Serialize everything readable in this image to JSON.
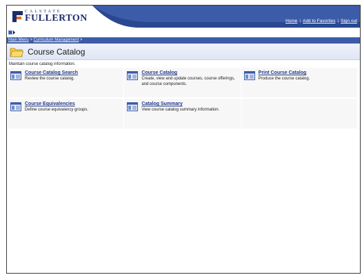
{
  "header": {
    "logo_top": "CALSTATE",
    "logo_main": "FULLERTON",
    "links": [
      "Home",
      "Add to Favorites",
      "Sign out"
    ]
  },
  "breadcrumb": {
    "items": [
      "Main Menu",
      "Curriculum Management"
    ],
    "separator": ">"
  },
  "page": {
    "title": "Course Catalog",
    "description": "Maintain course catalog information."
  },
  "items": [
    {
      "label": "Course Catalog Search",
      "desc": "Review the course catalog."
    },
    {
      "label": "Course Catalog",
      "desc": "Create, view and update courses, course offerings, and course components."
    },
    {
      "label": "Print Course Catalog",
      "desc": "Produce the course catalog."
    },
    {
      "label": "Course Equivalencies",
      "desc": "Define course equivalency groups."
    },
    {
      "label": "Catalog Summary",
      "desc": "View course catalog summary information."
    }
  ],
  "colors": {
    "brand_navy": "#1c2d6b",
    "brand_orange": "#e36f1e",
    "breadcrumb_bg": "#3c5ba8",
    "link": "#20388a"
  },
  "icons": {
    "logo": "csuf-logo-icon",
    "folder": "folder-icon",
    "item": "component-page-icon",
    "toolbar": "menu-toggle-icon"
  }
}
